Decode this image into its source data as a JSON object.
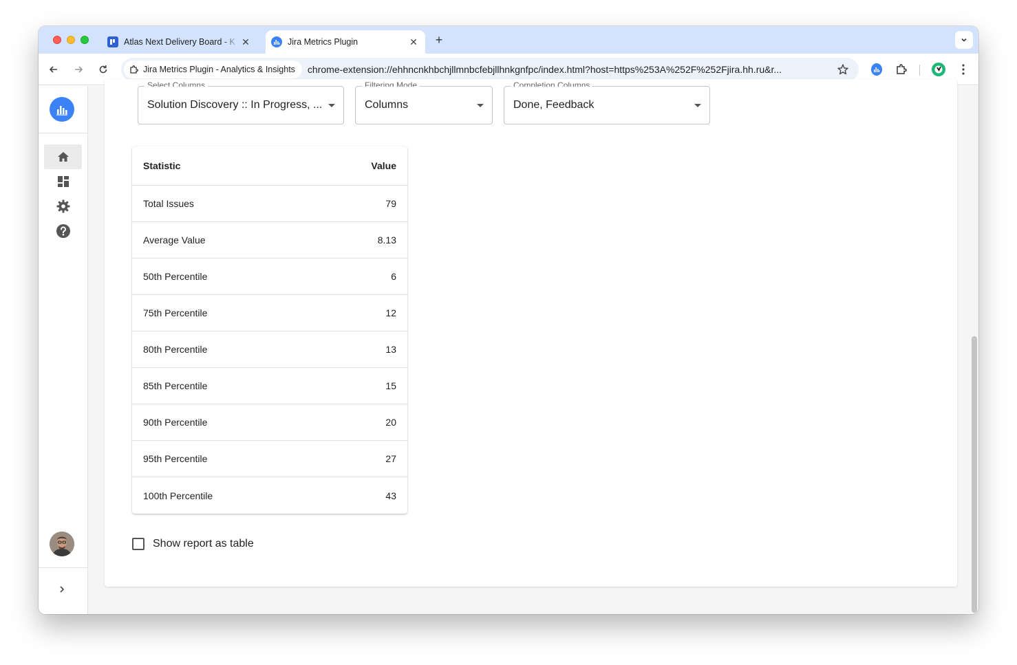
{
  "browser": {
    "tabs": [
      {
        "title": "Atlas Next Delivery Board - K",
        "active": false
      },
      {
        "title": "Jira Metrics Plugin",
        "active": true
      }
    ],
    "site_chip": "Jira Metrics Plugin - Analytics & Insights",
    "url": "chrome-extension://ehhncnkhbchjllmnbcfebjllhnkgnfpc/index.html?host=https%253A%252F%252Fjira.hh.ru&r...",
    "accent": "#d3e3fd"
  },
  "sidebar": {
    "items": [
      {
        "icon": "home-icon",
        "active": true
      },
      {
        "icon": "dashboard-icon",
        "active": false
      },
      {
        "icon": "gear-icon",
        "active": false
      },
      {
        "icon": "help-icon",
        "active": false
      }
    ],
    "brand_color": "#3b82f6"
  },
  "filters": {
    "select_columns": {
      "label": "Select Columns",
      "value": "Solution Discovery :: In Progress, ..."
    },
    "filtering_mode": {
      "label": "Filtering Mode",
      "value": "Columns"
    },
    "completion_columns": {
      "label": "Completion Columns",
      "value": "Done, Feedback"
    }
  },
  "stats_table": {
    "headers": {
      "statistic": "Statistic",
      "value": "Value"
    },
    "rows": [
      {
        "statistic": "Total Issues",
        "value": "79"
      },
      {
        "statistic": "Average Value",
        "value": "8.13"
      },
      {
        "statistic": "50th Percentile",
        "value": "6"
      },
      {
        "statistic": "75th Percentile",
        "value": "12"
      },
      {
        "statistic": "80th Percentile",
        "value": "13"
      },
      {
        "statistic": "85th Percentile",
        "value": "15"
      },
      {
        "statistic": "90th Percentile",
        "value": "20"
      },
      {
        "statistic": "95th Percentile",
        "value": "27"
      },
      {
        "statistic": "100th Percentile",
        "value": "43"
      }
    ]
  },
  "show_report_checkbox": {
    "label": "Show report as table",
    "checked": false
  }
}
